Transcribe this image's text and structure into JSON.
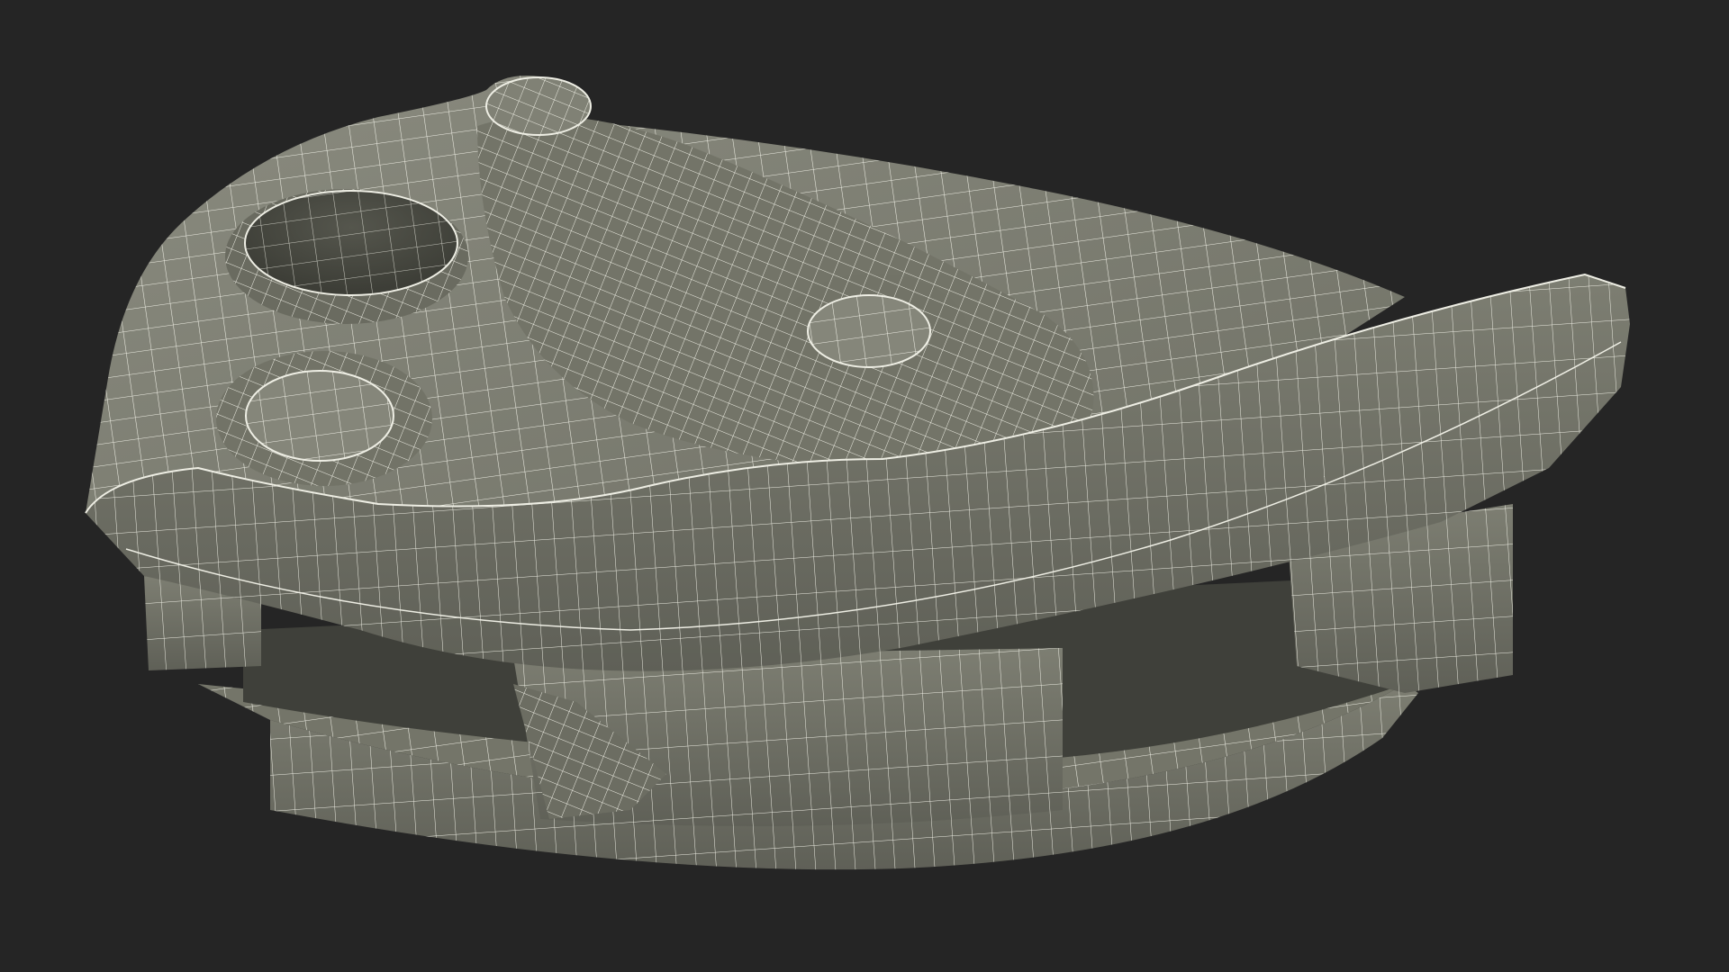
{
  "scene": {
    "background_color": "#252525",
    "surface_color": "#7b7c70",
    "surface_shadow_color": "#4d4e45",
    "surface_highlight_color": "#8e8f83",
    "wire_color": "#f2f2ea"
  }
}
